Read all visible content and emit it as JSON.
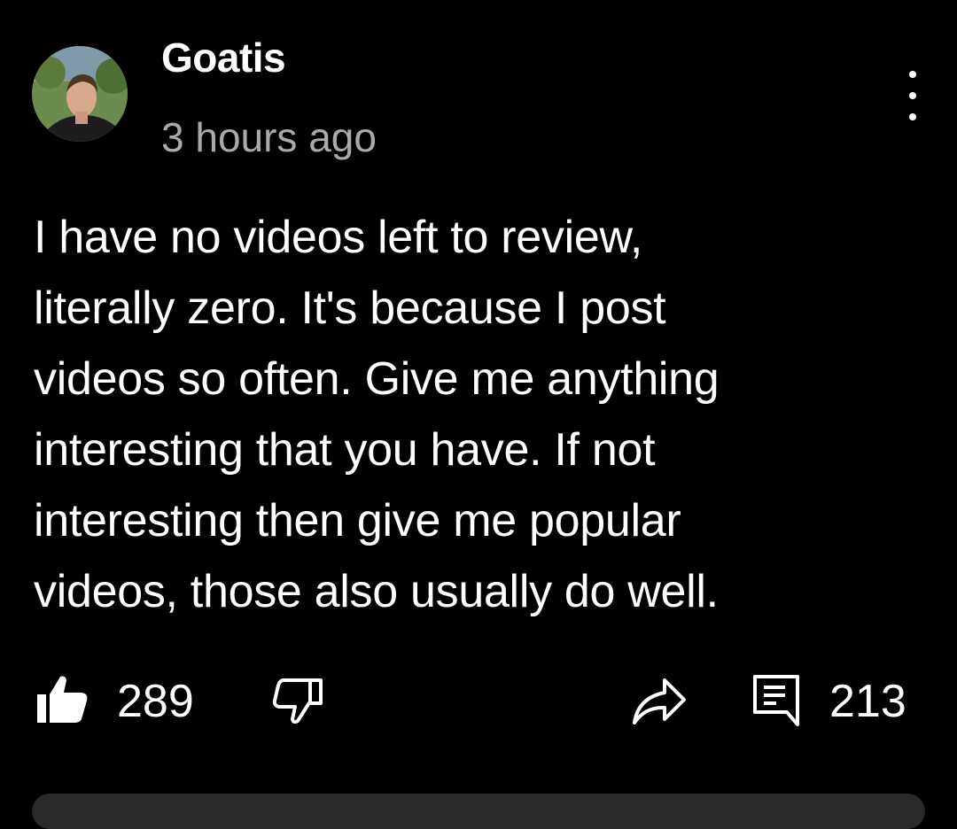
{
  "comment": {
    "author": "Goatis",
    "timestamp": "3 hours ago",
    "body_lines": [
      "I have no videos left to review,",
      "literally zero. It's because I post",
      "videos so often. Give me anything",
      "interesting that you have. If not",
      "interesting then give me popular",
      "videos, those also usually do well."
    ],
    "like_count": "289",
    "reply_count": "213"
  },
  "icons": {
    "avatar": "avatar-icon",
    "more": "more-vert-icon",
    "like": "thumbs-up-icon",
    "dislike": "thumbs-down-icon",
    "share": "share-arrow-icon",
    "reply": "comment-icon"
  },
  "colors": {
    "background": "#000000",
    "text": "#ffffff",
    "secondary_text": "#aaaaaa"
  }
}
